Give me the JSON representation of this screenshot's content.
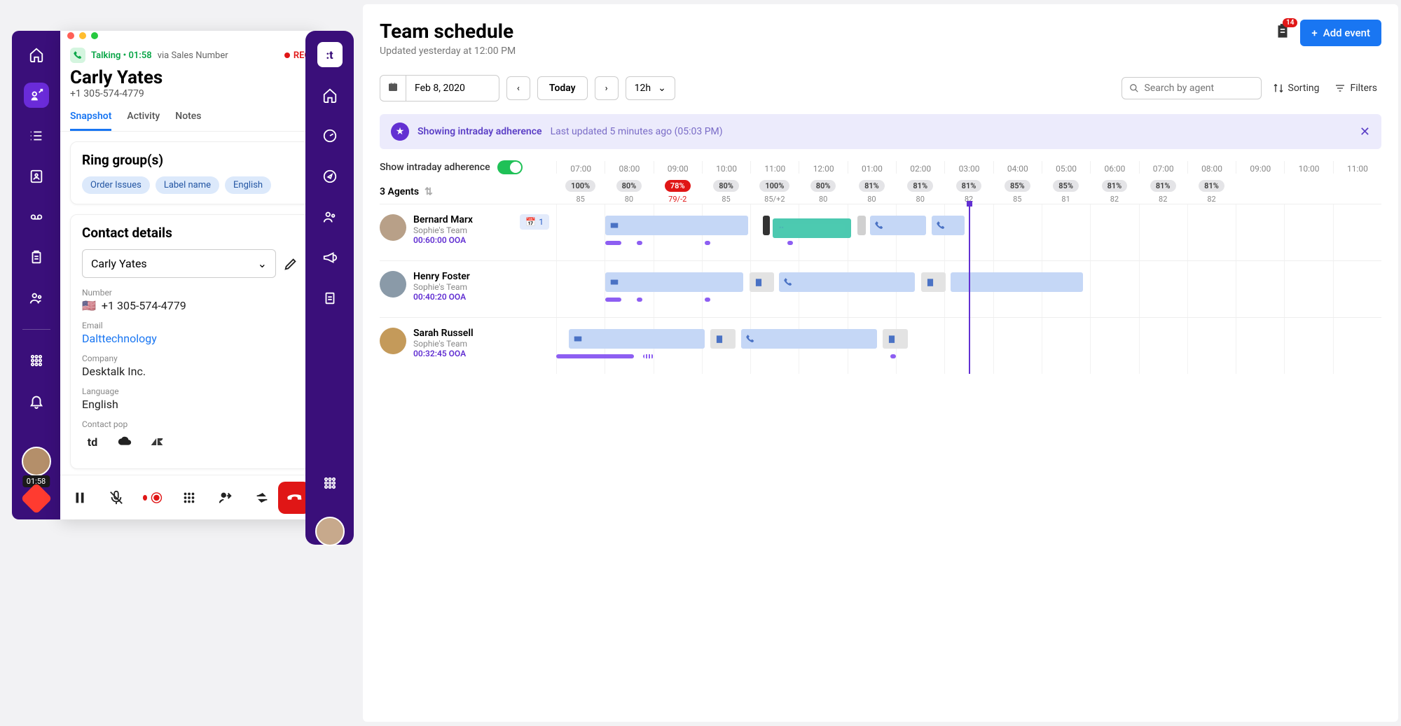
{
  "call": {
    "status_label": "Talking",
    "duration": "01:58",
    "via": "via Sales Number",
    "rec_label": "REC",
    "caller_name": "Carly Yates",
    "caller_number": "+1 305-574-4779",
    "tabs": {
      "snapshot": "Snapshot",
      "activity": "Activity",
      "notes": "Notes"
    },
    "ring_groups": {
      "title": "Ring group(s)",
      "chips": [
        "Order Issues",
        "Label name",
        "English"
      ]
    },
    "contact": {
      "title": "Contact details",
      "selected": "Carly Yates",
      "fields": {
        "number_label": "Number",
        "number_value": "+1 305-574-4779",
        "email_label": "Email",
        "email_value": "Dalttechnology",
        "company_label": "Company",
        "company_value": "Desktalk Inc.",
        "language_label": "Language",
        "language_value": "English",
        "pop_label": "Contact pop"
      }
    },
    "avatar_timer": "01:58"
  },
  "page": {
    "title": "Team schedule",
    "subtitle": "Updated yesterday at 12:00 PM",
    "notif_count": "14",
    "add_event": "Add event",
    "date": "Feb 8, 2020",
    "today": "Today",
    "zoom": "12h",
    "search_placeholder": "Search by agent",
    "sorting": "Sorting",
    "filters": "Filters",
    "banner_main": "Showing intraday adherence",
    "banner_sub": "Last updated 5 minutes ago (05:03 PM)",
    "toggle_label": "Show intraday adherence",
    "agents_count": "3 Agents",
    "hours": [
      "07:00",
      "08:00",
      "09:00",
      "10:00",
      "11:00",
      "12:00",
      "01:00",
      "02:00",
      "03:00",
      "04:00",
      "05:00",
      "06:00",
      "07:00",
      "08:00",
      "09:00",
      "10:00",
      "11:00"
    ],
    "stats": [
      {
        "pct": "100%",
        "sub": "85"
      },
      {
        "pct": "80%",
        "sub": "80"
      },
      {
        "pct": "78%",
        "sub": "79/-2",
        "red": true
      },
      {
        "pct": "80%",
        "sub": "85"
      },
      {
        "pct": "100%",
        "sub": "85/+2"
      },
      {
        "pct": "80%",
        "sub": "80"
      },
      {
        "pct": "81%",
        "sub": "80"
      },
      {
        "pct": "81%",
        "sub": "80"
      },
      {
        "pct": "81%",
        "sub": "82"
      },
      {
        "pct": "85%",
        "sub": "85"
      },
      {
        "pct": "85%",
        "sub": "81"
      },
      {
        "pct": "81%",
        "sub": "82"
      },
      {
        "pct": "81%",
        "sub": "82"
      },
      {
        "pct": "81%",
        "sub": "82"
      }
    ],
    "agents": [
      {
        "name": "Bernard Marx",
        "team": "Sophie's Team",
        "ooa": "00:60:00 OOA",
        "badge": "1"
      },
      {
        "name": "Henry Foster",
        "team": "Sophie's Team",
        "ooa": "00:40:20 OOA"
      },
      {
        "name": "Sarah Russell",
        "team": "Sophie's Team",
        "ooa": "00:32:45 OOA"
      }
    ]
  }
}
